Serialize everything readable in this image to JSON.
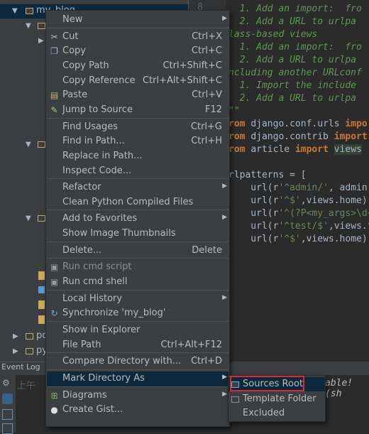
{
  "project_tree": {
    "root_label": "my_blog",
    "items": [
      {
        "label": "po"
      },
      {
        "label": "py"
      }
    ]
  },
  "editor": {
    "line_number": "8",
    "lines": [
      {
        "parts": [
          {
            "cls": "c-doc",
            "text": "  1. Add an import:  fro"
          }
        ]
      },
      {
        "parts": [
          {
            "cls": "c-doc",
            "text": "  2. Add a URL to urlpa"
          }
        ]
      },
      {
        "parts": [
          {
            "cls": "c-doc",
            "text": "lass-based views"
          }
        ]
      },
      {
        "parts": [
          {
            "cls": "c-doc",
            "text": "  1. Add an import:  fro"
          }
        ]
      },
      {
        "parts": [
          {
            "cls": "c-doc",
            "text": "  2. Add a URL to urlpa"
          }
        ]
      },
      {
        "parts": [
          {
            "cls": "c-doc",
            "text": "ncluding another URLconf"
          }
        ]
      },
      {
        "parts": [
          {
            "cls": "c-doc",
            "text": "  1. Import the include"
          }
        ]
      },
      {
        "parts": [
          {
            "cls": "c-doc",
            "text": "  2. Add a URL to urlpa"
          }
        ]
      },
      {
        "parts": [
          {
            "cls": "c-doc",
            "text": "\"\""
          }
        ]
      },
      {
        "parts": [
          {
            "cls": "c-kw",
            "text": "rom "
          },
          {
            "cls": "c-txt",
            "text": "django.conf.urls "
          },
          {
            "cls": "c-kw",
            "text": "impo"
          }
        ]
      },
      {
        "parts": [
          {
            "cls": "c-kw",
            "text": "rom "
          },
          {
            "cls": "c-txt",
            "text": "django.contrib "
          },
          {
            "cls": "c-kw",
            "text": "import"
          }
        ]
      },
      {
        "parts": [
          {
            "cls": "c-kw",
            "text": "rom "
          },
          {
            "cls": "c-txt",
            "text": "article "
          },
          {
            "cls": "c-kw",
            "text": "import "
          },
          {
            "cls": "c-hl",
            "text": "views"
          }
        ]
      },
      {
        "parts": [
          {
            "cls": "c-txt",
            "text": ""
          }
        ]
      },
      {
        "parts": [
          {
            "cls": "c-txt",
            "text": "rlpatterns = ["
          }
        ]
      },
      {
        "parts": [
          {
            "cls": "c-txt",
            "text": "    url(r"
          },
          {
            "cls": "c-str",
            "text": "'^admin/'"
          },
          {
            "cls": "c-txt",
            "text": ", admin"
          }
        ]
      },
      {
        "parts": [
          {
            "cls": "c-txt",
            "text": "    url(r"
          },
          {
            "cls": "c-str",
            "text": "'^$'"
          },
          {
            "cls": "c-txt",
            "text": ",views.home),"
          }
        ]
      },
      {
        "parts": [
          {
            "cls": "c-txt",
            "text": "    url(r"
          },
          {
            "cls": "c-str",
            "text": "'^(?P<my_args>\\d+"
          }
        ]
      },
      {
        "parts": [
          {
            "cls": "c-txt",
            "text": "    url(r"
          },
          {
            "cls": "c-str",
            "text": "'^test/$'"
          },
          {
            "cls": "c-txt",
            "text": ",views.t"
          }
        ]
      },
      {
        "parts": [
          {
            "cls": "c-txt",
            "text": "    url(r"
          },
          {
            "cls": "c-str",
            "text": "'^$'"
          },
          {
            "cls": "c-txt",
            "text": ",views.home)"
          }
        ]
      }
    ]
  },
  "event_log": {
    "title": "Event Log",
    "time_fragment": "上午",
    "message_fragment": "able! (sh"
  },
  "context_menu": {
    "items": [
      {
        "label": "New",
        "shortcut": "",
        "submenu": true,
        "icon": "",
        "disabled": false
      },
      {
        "sep": true
      },
      {
        "label": "Cut",
        "shortcut": "Ctrl+X",
        "icon": "scissors",
        "disabled": false
      },
      {
        "label": "Copy",
        "shortcut": "Ctrl+C",
        "icon": "copy",
        "disabled": false
      },
      {
        "label": "Copy Path",
        "shortcut": "Ctrl+Shift+C",
        "icon": "",
        "disabled": false
      },
      {
        "label": "Copy Reference",
        "shortcut": "Ctrl+Alt+Shift+C",
        "icon": "",
        "disabled": false
      },
      {
        "label": "Paste",
        "shortcut": "Ctrl+V",
        "icon": "paste",
        "disabled": false
      },
      {
        "label": "Jump to Source",
        "shortcut": "F12",
        "icon": "jump",
        "disabled": false
      },
      {
        "sep": true
      },
      {
        "label": "Find Usages",
        "shortcut": "Ctrl+G",
        "icon": "",
        "disabled": false
      },
      {
        "label": "Find in Path...",
        "shortcut": "Ctrl+H",
        "icon": "",
        "disabled": false
      },
      {
        "label": "Replace in Path...",
        "shortcut": "",
        "icon": "",
        "disabled": false
      },
      {
        "label": "Inspect Code...",
        "shortcut": "",
        "icon": "",
        "disabled": false
      },
      {
        "sep": true
      },
      {
        "label": "Refactor",
        "shortcut": "",
        "submenu": true,
        "icon": "",
        "disabled": false
      },
      {
        "label": "Clean Python Compiled Files",
        "shortcut": "",
        "icon": "",
        "disabled": false
      },
      {
        "sep": true
      },
      {
        "label": "Add to Favorites",
        "shortcut": "",
        "submenu": true,
        "icon": "",
        "disabled": false
      },
      {
        "label": "Show Image Thumbnails",
        "shortcut": "",
        "icon": "",
        "disabled": false
      },
      {
        "sep": true
      },
      {
        "label": "Delete...",
        "shortcut": "Delete",
        "icon": "",
        "disabled": false
      },
      {
        "sep": true
      },
      {
        "label": "Run cmd script",
        "shortcut": "",
        "icon": "cmd",
        "disabled": true
      },
      {
        "label": "Run cmd shell",
        "shortcut": "",
        "icon": "cmd",
        "disabled": false
      },
      {
        "sep": true
      },
      {
        "label": "Local History",
        "shortcut": "",
        "submenu": true,
        "icon": "",
        "disabled": false
      },
      {
        "label": "Synchronize 'my_blog'",
        "shortcut": "",
        "icon": "sync",
        "disabled": false
      },
      {
        "sep": true
      },
      {
        "label": "Show in Explorer",
        "shortcut": "",
        "icon": "",
        "disabled": false
      },
      {
        "label": "File Path",
        "shortcut": "Ctrl+Alt+F12",
        "icon": "",
        "disabled": false
      },
      {
        "sep": true
      },
      {
        "label": "Compare Directory with...",
        "shortcut": "Ctrl+D",
        "icon": "",
        "disabled": false
      },
      {
        "sep": true
      },
      {
        "label": "Mark Directory As",
        "shortcut": "",
        "submenu": true,
        "icon": "",
        "disabled": false,
        "selected": true
      },
      {
        "sep": true
      },
      {
        "label": "Diagrams",
        "shortcut": "",
        "submenu": true,
        "icon": "diagram",
        "disabled": false
      },
      {
        "label": "Create Gist...",
        "shortcut": "",
        "icon": "github",
        "disabled": false
      }
    ]
  },
  "submenu": {
    "items": [
      {
        "label": "Sources Root",
        "icon": "sources-root-folder",
        "selected": true
      },
      {
        "label": "Template Folder",
        "icon": "template-folder",
        "selected": false
      },
      {
        "label": "Excluded",
        "icon": "",
        "selected": false
      }
    ]
  },
  "colors": {
    "selection": "#0d293e",
    "highlight_box": "#e02a2a",
    "menu_bg": "#3c3f41"
  }
}
